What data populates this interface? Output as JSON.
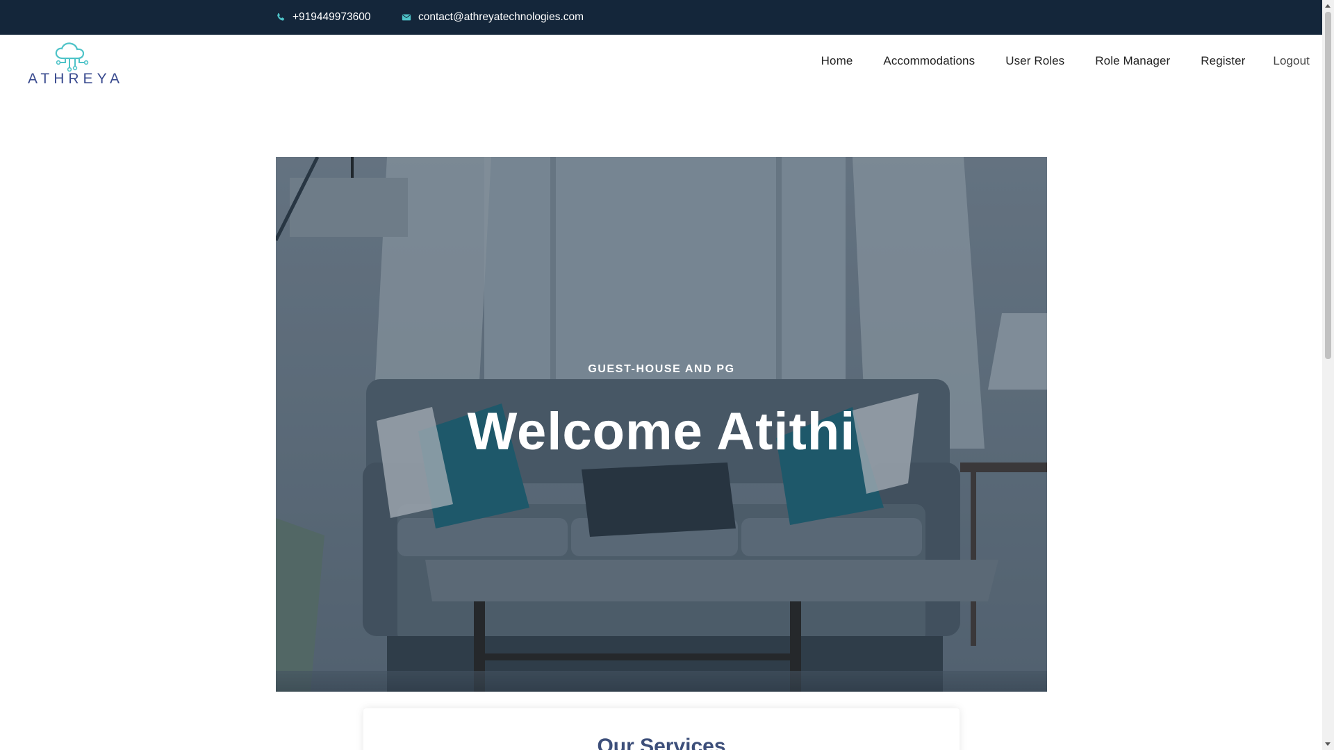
{
  "topbar": {
    "phone": "+919449973600",
    "email": "contact@athreyatechnologies.com",
    "phone_icon": "phone-icon",
    "email_icon": "envelope-icon"
  },
  "brand": {
    "logo_text": "ATHREYA",
    "logo_icon": "cloud-circuit-icon",
    "colors": {
      "icon": "#4ec3c8",
      "text": "#3a4b8f"
    }
  },
  "nav": {
    "items": [
      {
        "label": "Home"
      },
      {
        "label": "Accommodations"
      },
      {
        "label": "User Roles"
      },
      {
        "label": "Role Manager"
      },
      {
        "label": "Register"
      },
      {
        "label": "Logout"
      }
    ]
  },
  "hero": {
    "eyebrow": "GUEST-HOUSE AND PG",
    "title": "Welcome Atithi",
    "background_image": "living-room-sofa-photo"
  },
  "services": {
    "heading": "Our Services"
  },
  "colors": {
    "topbar_bg": "#14263a",
    "accent": "#4ec3c8",
    "heading": "#3d4f7a"
  }
}
